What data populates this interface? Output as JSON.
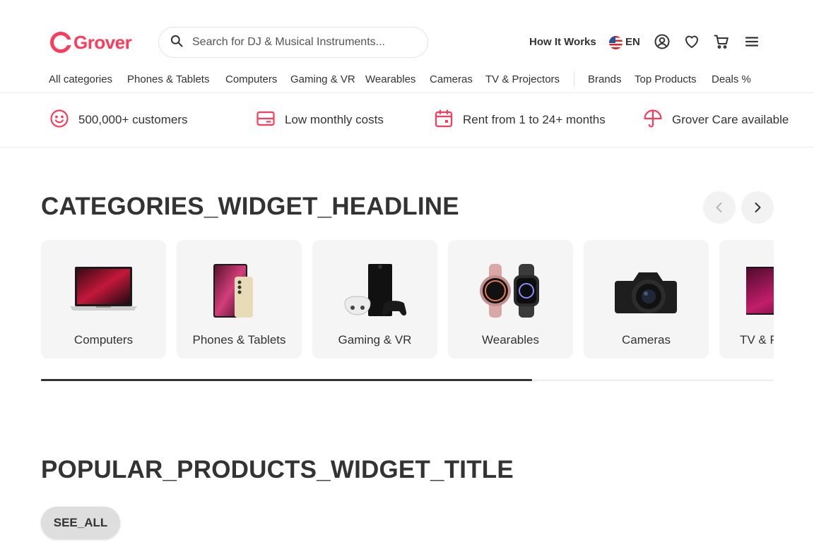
{
  "brand": {
    "name": "Grover",
    "color": "#ff3b5c"
  },
  "search": {
    "placeholder": "Search for DJ & Musical Instruments..."
  },
  "header": {
    "how_it_works": "How It Works",
    "language": "EN",
    "icons": [
      "account-icon",
      "heart-icon",
      "cart-icon",
      "menu-icon"
    ]
  },
  "nav": {
    "items": [
      {
        "label": "All categories"
      },
      {
        "label": "Phones & Tablets"
      },
      {
        "label": "Computers"
      },
      {
        "label": "Gaming & VR"
      },
      {
        "label": "Wearables"
      },
      {
        "label": "Cameras"
      },
      {
        "label": "TV & Projectors"
      },
      {
        "label": "Brands"
      },
      {
        "label": "Top Products"
      },
      {
        "label": "Deals %"
      }
    ]
  },
  "benefits": [
    {
      "icon": "smiley-icon",
      "text": "500,000+ customers"
    },
    {
      "icon": "card-icon",
      "text": "Low monthly costs"
    },
    {
      "icon": "calendar-icon",
      "text": "Rent from 1 to 24+ months"
    },
    {
      "icon": "umbrella-icon",
      "text": "Grover Care available"
    }
  ],
  "categories_widget": {
    "headline": "CATEGORIES_WIDGET_HEADLINE",
    "cards": [
      {
        "label": "Computers"
      },
      {
        "label": "Phones & Tablets"
      },
      {
        "label": "Gaming & VR"
      },
      {
        "label": "Wearables"
      },
      {
        "label": "Cameras"
      },
      {
        "label": "TV & Projectors"
      }
    ],
    "scroll_progress": 0.67
  },
  "popular_products": {
    "title": "POPULAR_PRODUCTS_WIDGET_TITLE",
    "see_all": "SEE_ALL"
  }
}
